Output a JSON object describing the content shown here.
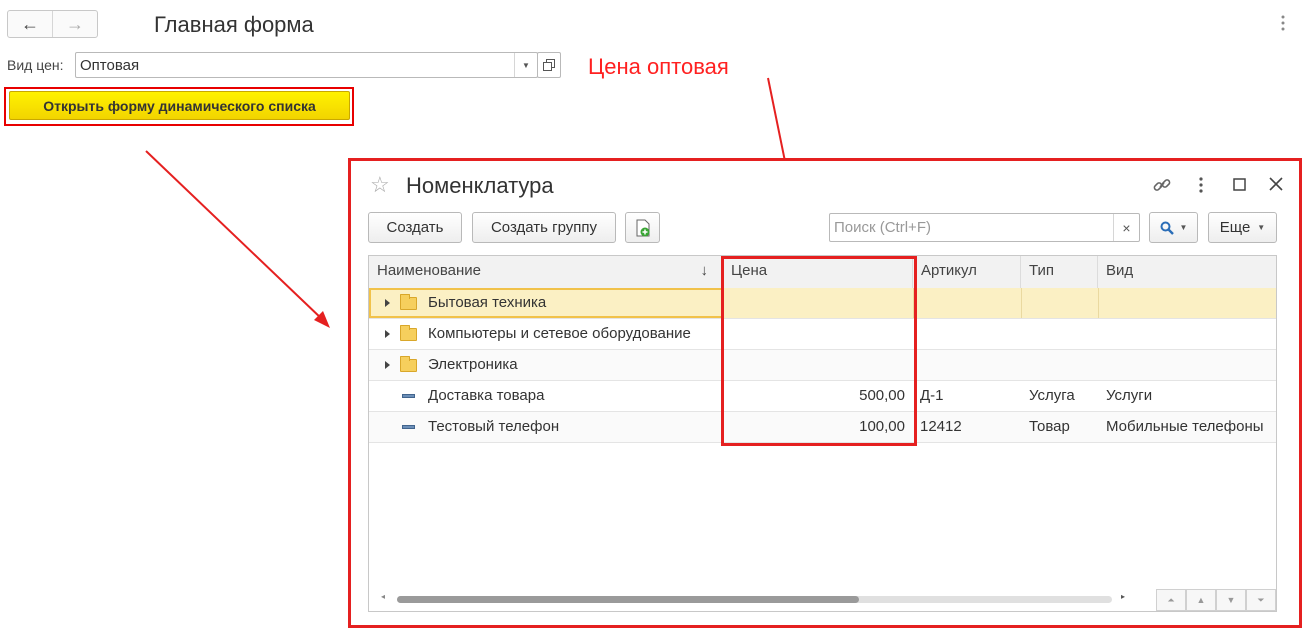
{
  "main": {
    "title": "Главная форма",
    "back_icon": "←",
    "forward_icon": "→",
    "price_type_label": "Вид цен:",
    "price_type_value": "Оптовая",
    "open_list_button": "Открыть форму динамического списка",
    "annotation": "Цена оптовая"
  },
  "window": {
    "title": "Номенклатура",
    "toolbar": {
      "create": "Создать",
      "create_group": "Создать группу",
      "search_placeholder": "Поиск (Ctrl+F)",
      "more": "Еще",
      "search_clear": "×"
    },
    "columns": [
      "Наименование",
      "Цена",
      "Артикул",
      "Тип",
      "Вид"
    ],
    "sort_indicator": "↓",
    "rows": [
      {
        "kind": "group",
        "name": "Бытовая техника",
        "price": "",
        "article": "",
        "type": "",
        "view": ""
      },
      {
        "kind": "group",
        "name": "Компьютеры и сетевое оборудование",
        "price": "",
        "article": "",
        "type": "",
        "view": ""
      },
      {
        "kind": "group",
        "name": "Электроника",
        "price": "",
        "article": "",
        "type": "",
        "view": ""
      },
      {
        "kind": "item",
        "name": "Доставка товара",
        "price": "500,00",
        "article": "Д-1",
        "type": "Услуга",
        "view": "Услуги"
      },
      {
        "kind": "item",
        "name": "Тестовый телефон",
        "price": "100,00",
        "article": "12412",
        "type": "Товар",
        "view": "Мобильные телефоны"
      }
    ]
  },
  "colors": {
    "annotation": "#e52020",
    "button_yellow": "#fff200",
    "selected_row": "#fbf0c4"
  }
}
